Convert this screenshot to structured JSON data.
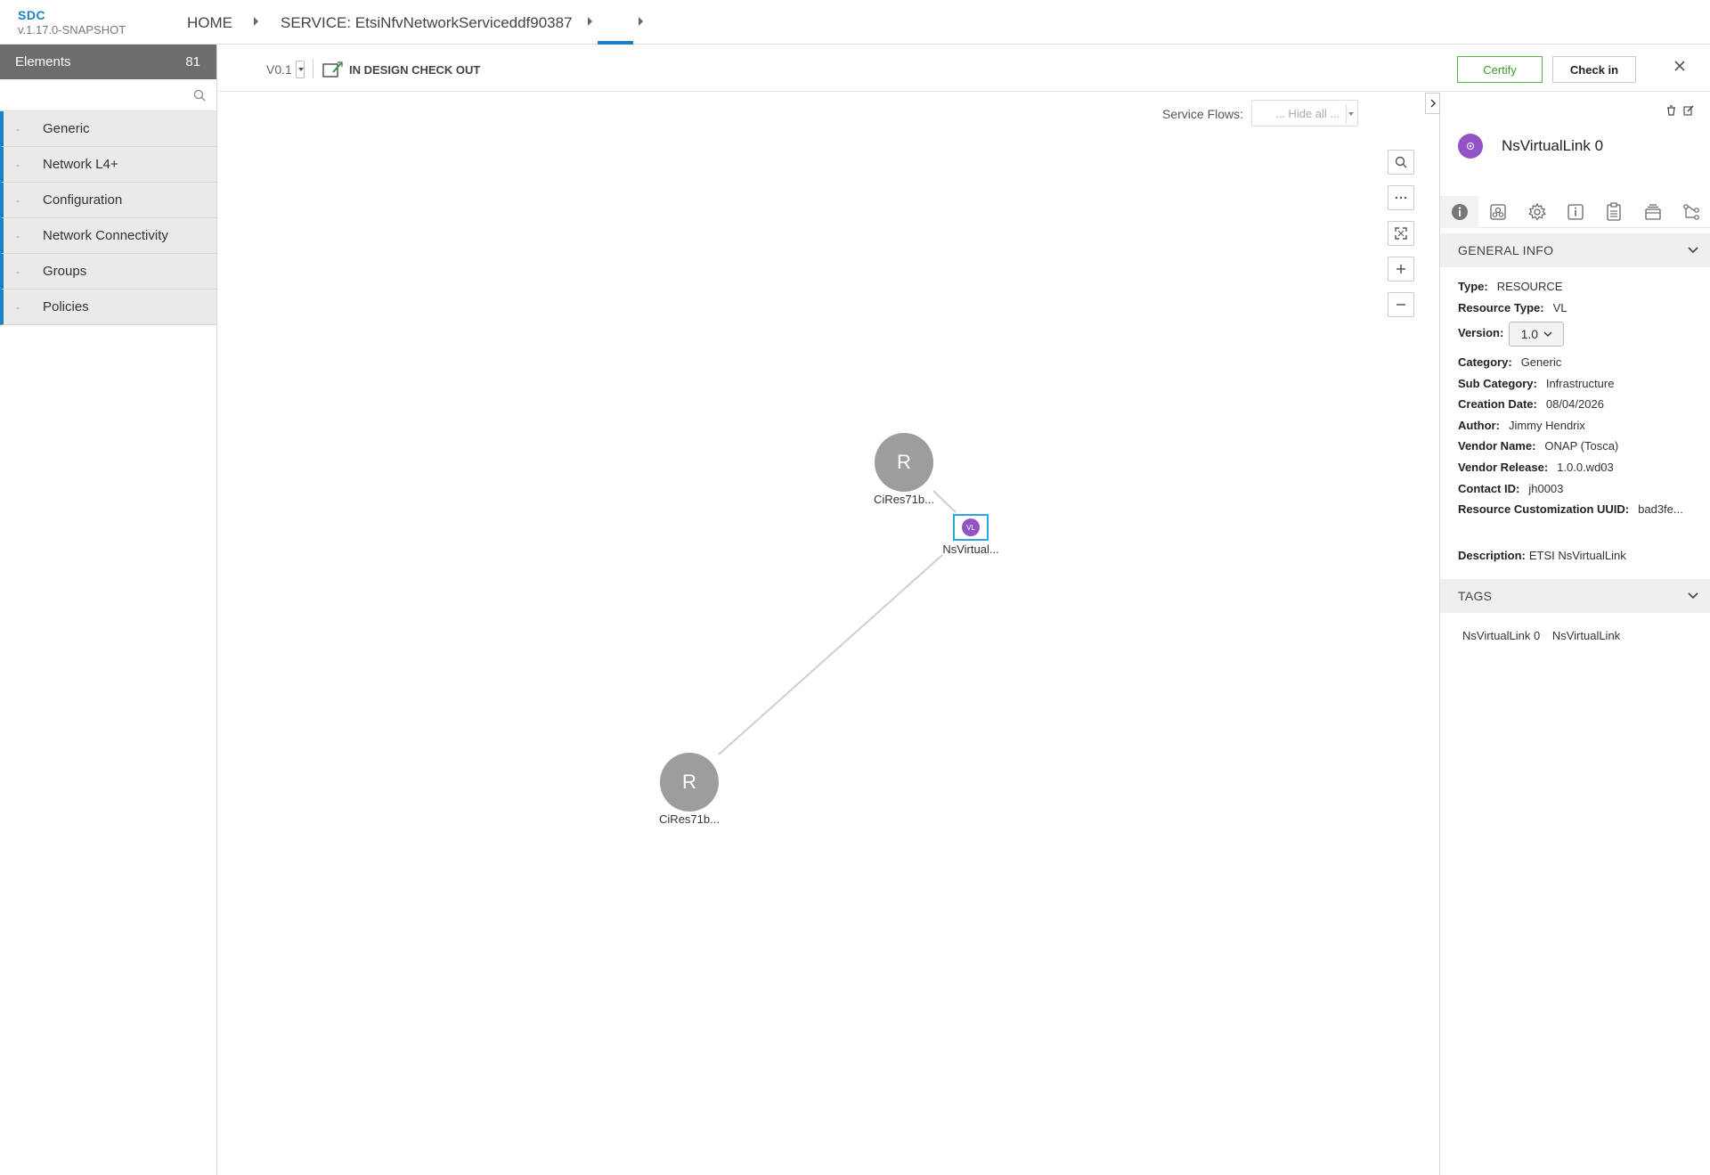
{
  "header": {
    "brand": "SDC",
    "version": "v.1.17.0-SNAPSHOT",
    "breadcrumbs": [
      "HOME",
      "SERVICE: EtsiNfvNetworkServiceddf90387"
    ]
  },
  "palette": {
    "title": "Elements",
    "count": "81",
    "search_placeholder": "",
    "groups": [
      {
        "label": "Generic"
      },
      {
        "label": "Network L4+"
      },
      {
        "label": "Configuration"
      },
      {
        "label": "Network Connectivity"
      },
      {
        "label": "Groups"
      },
      {
        "label": "Policies"
      }
    ],
    "accent_color": "#1a82c4"
  },
  "toolbar": {
    "version": "V0.1",
    "status": "IN DESIGN CHECK OUT",
    "certify_label": "Certify",
    "checkin_label": "Check in"
  },
  "canvas": {
    "service_flows_label": "Service Flows:",
    "service_flows_value": "... Hide all ...",
    "nodes": [
      {
        "letter": "R",
        "label": "CiRes71b..."
      },
      {
        "letter": "R",
        "label": "CiRes71b..."
      }
    ],
    "vl_node": {
      "letter": "VL",
      "label": "NsVirtual..."
    }
  },
  "panel": {
    "title": "NsVirtualLink 0",
    "general_info_title": "GENERAL INFO",
    "fields": {
      "type_label": "Type:",
      "type_value": "RESOURCE",
      "rtype_label": "Resource Type:",
      "rtype_value": "VL",
      "version_label": "Version:",
      "version_value": "1.0",
      "category_label": "Category:",
      "category_value": "Generic",
      "subcat_label": "Sub Category:",
      "subcat_value": "Infrastructure",
      "created_label": "Creation Date:",
      "created_value": "08/04/2026",
      "author_label": "Author:",
      "author_value": "Jimmy Hendrix",
      "vendor_label": "Vendor Name:",
      "vendor_value": "ONAP (Tosca)",
      "release_label": "Vendor Release:",
      "release_value": "1.0.0.wd03",
      "contact_label": "Contact ID:",
      "contact_value": "jh0003",
      "uuid_label": "Resource Customization UUID:",
      "uuid_value": "bad3fe...",
      "desc_label": "Description:",
      "desc_value": "ETSI NsVirtualLink"
    },
    "tags_title": "TAGS",
    "tags": [
      "NsVirtualLink 0",
      "NsVirtualLink"
    ],
    "vl_color": "#9253c6"
  }
}
